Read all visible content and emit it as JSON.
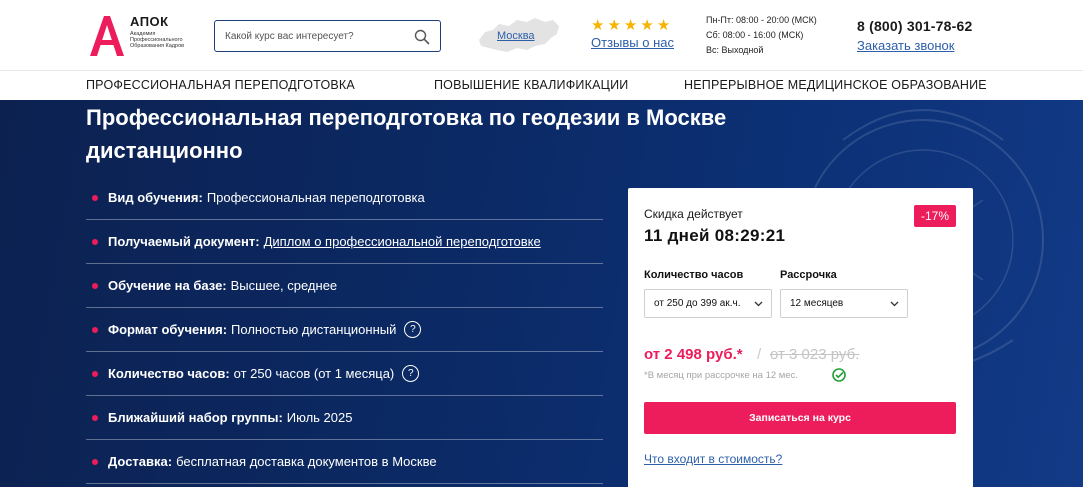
{
  "header": {
    "logo": {
      "mark": "А",
      "name": "АПОК",
      "subtitle": "Академия Профессионального Образования Кадров"
    },
    "search": {
      "placeholder": "Какой курс вас интересует?",
      "value": ""
    },
    "city": "Москва",
    "rating_stars": 5,
    "reviews_link": "Отзывы о нас",
    "schedule": [
      "Пн-Пт: 08:00 - 20:00 (МСК)",
      "Сб: 08:00 - 16:00 (МСК)",
      "Вс: Выходной"
    ],
    "phone": "8 (800) 301-78-62",
    "callback_link": "Заказать звонок"
  },
  "nav": {
    "items": [
      {
        "label": "ПРОФЕССИОНАЛЬНАЯ ПЕРЕПОДГОТОВКА"
      },
      {
        "label": "ПОВЫШЕНИЕ КВАЛИФИКАЦИИ"
      },
      {
        "label": "НЕПРЕРЫВНОЕ МЕДИЦИНСКОЕ ОБРАЗОВАНИЕ"
      }
    ]
  },
  "hero": {
    "title": "Профессиональная переподготовка по геодезии в Москве дистанционно",
    "features": [
      {
        "label": "Вид обучения:",
        "value": "Профессиональная переподготовка"
      },
      {
        "label": "Получаемый документ:",
        "link": "Диплом о профессиональной переподготовке"
      },
      {
        "label": "Обучение на базе:",
        "value": "Высшее, среднее"
      },
      {
        "label": "Формат обучения:",
        "value": "Полностью дистанционный",
        "help": "?"
      },
      {
        "label": "Количество часов:",
        "value": "от 250 часов (от 1 месяца)",
        "help": "?"
      },
      {
        "label": "Ближайший набор группы:",
        "value": "Июль 2025"
      },
      {
        "label": "Доставка:",
        "value": "бесплатная доставка документов в Москве"
      }
    ]
  },
  "card": {
    "discount_label": "Скидка действует",
    "discount_badge": "-17%",
    "timer": "11 дней 08:29:21",
    "hours_label": "Количество часов",
    "hours_selected": "от 250 до 399 ак.ч.",
    "installment_label": "Рассрочка",
    "installment_selected": "12 месяцев",
    "price_now": "от 2 498 руб.*",
    "price_separator": "/",
    "price_old": "от 3 023 руб.",
    "price_note": "*В месяц при рассрочке на 12 мес.",
    "enroll_button": "Записаться на курс",
    "cost_link": "Что входит в стоимость?"
  },
  "colors": {
    "brand_red": "#ed1c5b",
    "hero_blue": "#0b2a66",
    "link_blue": "#2d5fa8",
    "star_gold": "#f6b400"
  }
}
